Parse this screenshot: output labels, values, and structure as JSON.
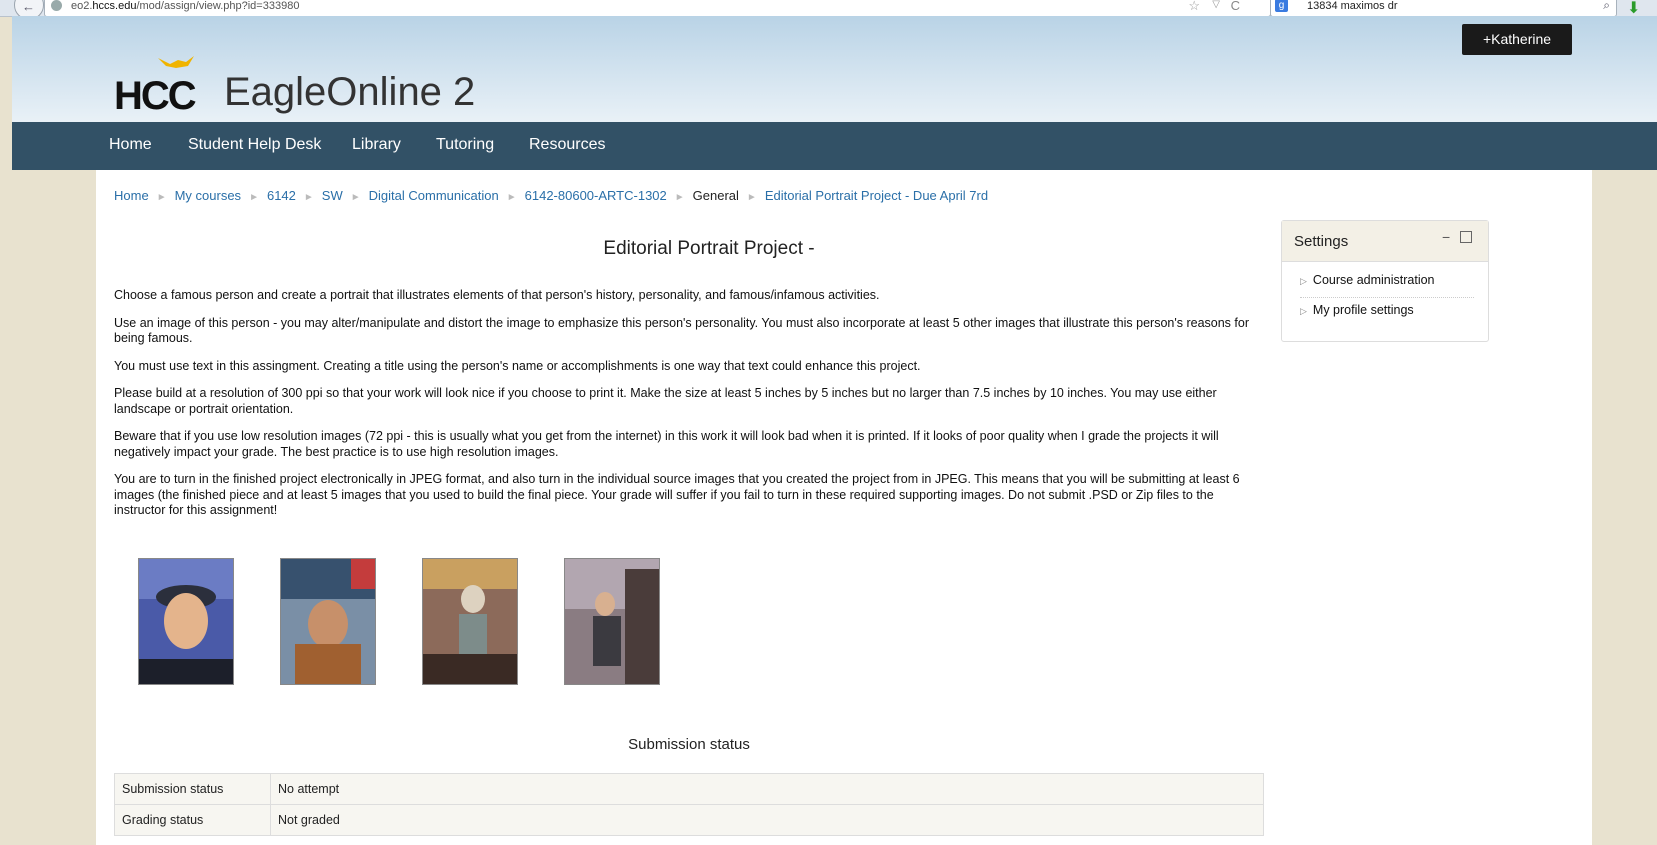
{
  "browser": {
    "back_glyph": "←",
    "url_host": "eo2.hccs.edu",
    "url_domain": "hccs.edu",
    "url_path": "/mod/assign/view.php?id=333980",
    "url_prefix": "eo2.",
    "search_engine_glyph": "g",
    "search_text": "13834 maximos dr",
    "star_glyph": "☆",
    "dropdown_glyph": "▽",
    "reload_glyph": "C",
    "search_glyph": "⌕",
    "download_glyph": "⬇"
  },
  "header": {
    "logo_hcc": "HCC",
    "logo_name": "EagleOnline 2",
    "user_button": "Katherine",
    "user_prefix": "+"
  },
  "nav": {
    "items": [
      "Home",
      "Student Help Desk",
      "Library",
      "Tutoring",
      "Resources"
    ]
  },
  "breadcrumb": {
    "items": [
      "Home",
      "My courses",
      "6142",
      "SW",
      "Digital Communication",
      "6142-80600-ARTC-1302",
      "General",
      "Editorial Portrait Project - Due April 7rd"
    ],
    "separator": "►"
  },
  "assignment": {
    "title": "Editorial Portrait Project -",
    "paragraphs": [
      "Choose a famous person and create a portrait that illustrates elements of that person's history, personality, and famous/infamous activities.",
      "Use an image of this person - you may alter/manipulate and distort the image to emphasize this person's personality. You must also incorporate at least 5 other images that illustrate this person's reasons for being famous.",
      "You must use text in this assingment. Creating a title using the person's name or accomplishments is one way that text could enhance this project.",
      "Please build at a resolution of 300 ppi so that your work will look nice if you choose to print it. Make the size at least 5 inches by 5 inches but no larger than 7.5 inches by 10 inches. You may use either landscape or portrait orientation.",
      "Beware that if you use low resolution images (72 ppi - this is usually what you get from the internet) in this work it will look bad when it is printed. If it looks of poor quality when I grade the projects it will negatively impact your grade. The best practice is to use high resolution images.",
      "You are to turn in the finished project electronically in JPEG format, and also turn in the individual source images that you created the project from in JPEG. This means that you will be submitting at least 6 images (the finished piece and at least 5 images that you used to build the final piece. Your grade will suffer if you fail to turn in these required supporting images. Do not submit .PSD or Zip files to the instructor for this assignment!"
    ]
  },
  "submission": {
    "heading": "Submission status",
    "rows": [
      {
        "label": "Submission status",
        "value": "No attempt"
      },
      {
        "label": "Grading status",
        "value": "Not graded"
      }
    ]
  },
  "settings": {
    "title": "Settings",
    "minimize_glyph": "−",
    "items": [
      "Course administration",
      "My profile settings"
    ],
    "expander_glyph": "▷"
  },
  "colors": {
    "navbar": "#325166",
    "link": "#2a6fa8",
    "page_bg": "#e8e2cf",
    "user_button": "#1a1a1a"
  }
}
